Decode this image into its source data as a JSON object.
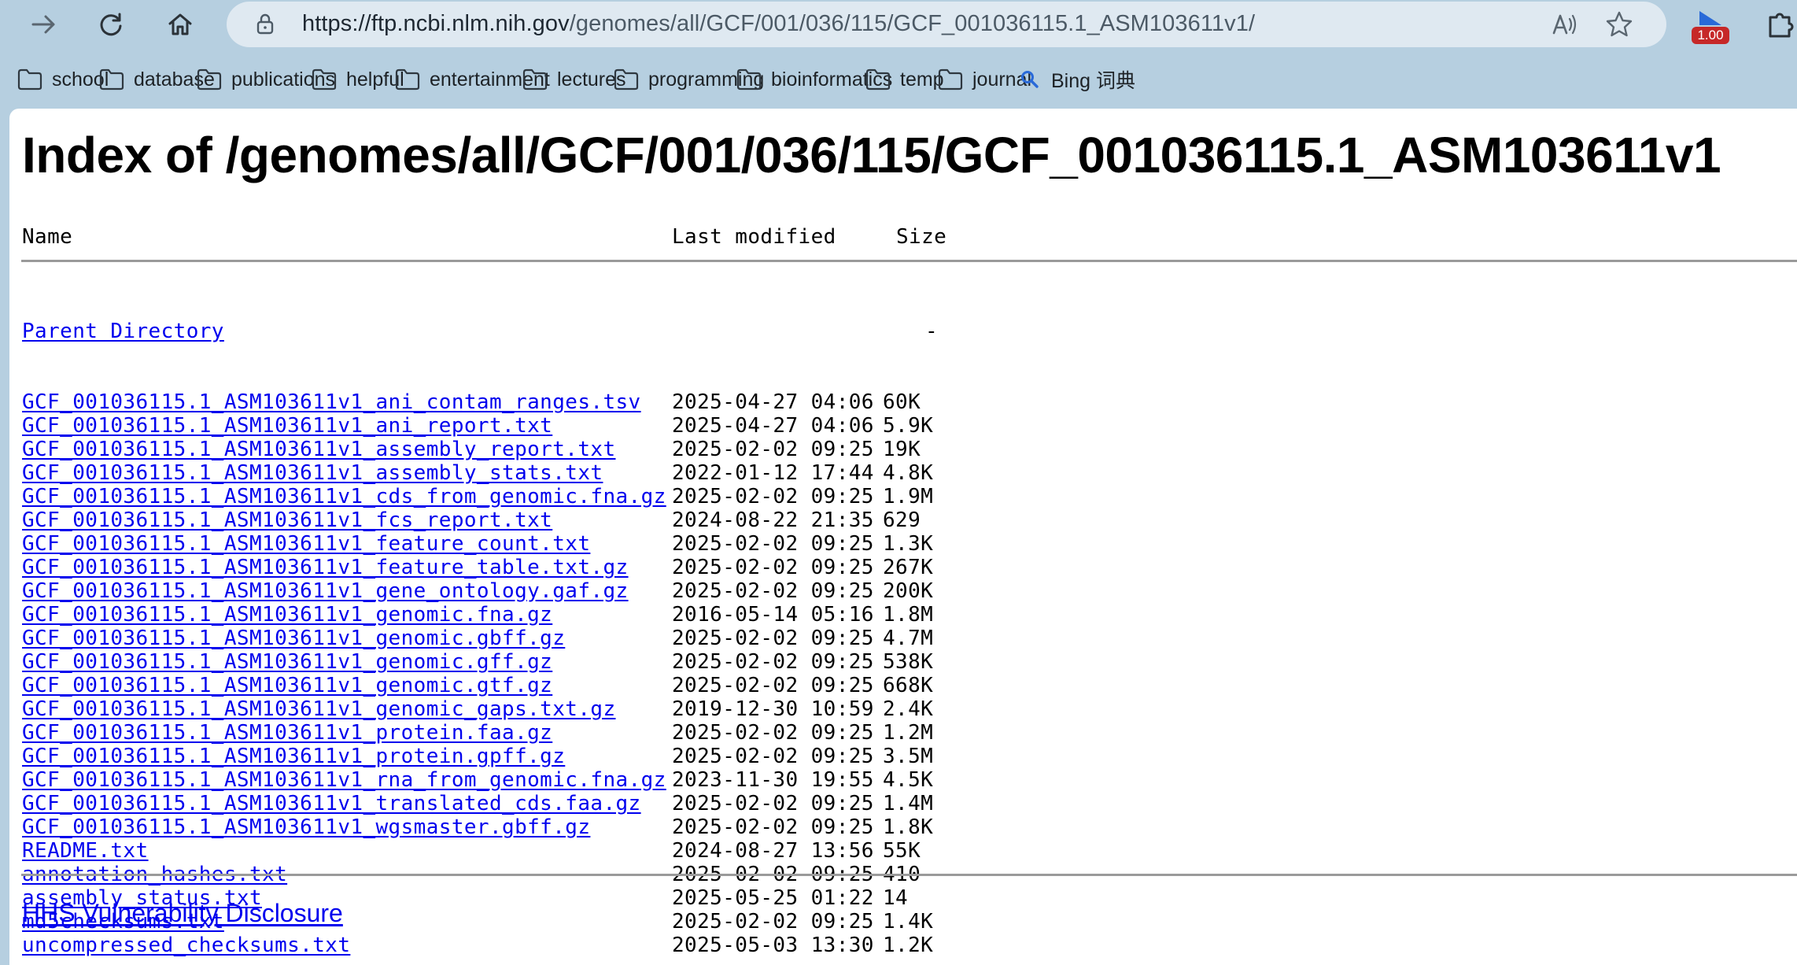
{
  "browser": {
    "url_host": "https://ftp.ncbi.nlm.nih.gov",
    "url_path": "/genomes/all/GCF/001/036/115/GCF_001036115.1_ASM103611v1/",
    "extension_badge": "1.00",
    "accent_color": "#2a6ad8",
    "badge_color": "#c62828"
  },
  "bookmarks": [
    {
      "label": "school",
      "icon": "folder-icon"
    },
    {
      "label": "database",
      "icon": "folder-icon"
    },
    {
      "label": "publications",
      "icon": "folder-icon"
    },
    {
      "label": "helpful",
      "icon": "folder-icon"
    },
    {
      "label": "entertainment",
      "icon": "folder-icon"
    },
    {
      "label": "lectures",
      "icon": "folder-icon"
    },
    {
      "label": "programming",
      "icon": "folder-icon"
    },
    {
      "label": "bioinformatics",
      "icon": "folder-icon"
    },
    {
      "label": "temp",
      "icon": "folder-icon"
    },
    {
      "label": "journal",
      "icon": "folder-icon"
    },
    {
      "label": "Bing 词典",
      "icon": "search-icon"
    }
  ],
  "page": {
    "title": "Index of /genomes/all/GCF/001/036/115/GCF_001036115.1_ASM103611v1",
    "columns": {
      "name": "Name",
      "modified": "Last modified",
      "size": "Size"
    },
    "parent": {
      "name": "Parent Directory",
      "modified": "",
      "size": "-"
    },
    "files": [
      {
        "name": "GCF_001036115.1_ASM103611v1_ani_contam_ranges.tsv",
        "modified": "2025-04-27 04:06",
        "size": "60K"
      },
      {
        "name": "GCF_001036115.1_ASM103611v1_ani_report.txt",
        "modified": "2025-04-27 04:06",
        "size": "5.9K"
      },
      {
        "name": "GCF_001036115.1_ASM103611v1_assembly_report.txt",
        "modified": "2025-02-02 09:25",
        "size": "19K"
      },
      {
        "name": "GCF_001036115.1_ASM103611v1_assembly_stats.txt",
        "modified": "2022-01-12 17:44",
        "size": "4.8K"
      },
      {
        "name": "GCF_001036115.1_ASM103611v1_cds_from_genomic.fna.gz",
        "modified": "2025-02-02 09:25",
        "size": "1.9M"
      },
      {
        "name": "GCF_001036115.1_ASM103611v1_fcs_report.txt",
        "modified": "2024-08-22 21:35",
        "size": "629"
      },
      {
        "name": "GCF_001036115.1_ASM103611v1_feature_count.txt",
        "modified": "2025-02-02 09:25",
        "size": "1.3K"
      },
      {
        "name": "GCF_001036115.1_ASM103611v1_feature_table.txt.gz",
        "modified": "2025-02-02 09:25",
        "size": "267K"
      },
      {
        "name": "GCF_001036115.1_ASM103611v1_gene_ontology.gaf.gz",
        "modified": "2025-02-02 09:25",
        "size": "200K"
      },
      {
        "name": "GCF_001036115.1_ASM103611v1_genomic.fna.gz",
        "modified": "2016-05-14 05:16",
        "size": "1.8M"
      },
      {
        "name": "GCF_001036115.1_ASM103611v1_genomic.gbff.gz",
        "modified": "2025-02-02 09:25",
        "size": "4.7M"
      },
      {
        "name": "GCF_001036115.1_ASM103611v1_genomic.gff.gz",
        "modified": "2025-02-02 09:25",
        "size": "538K"
      },
      {
        "name": "GCF_001036115.1_ASM103611v1_genomic.gtf.gz",
        "modified": "2025-02-02 09:25",
        "size": "668K"
      },
      {
        "name": "GCF_001036115.1_ASM103611v1_genomic_gaps.txt.gz",
        "modified": "2019-12-30 10:59",
        "size": "2.4K"
      },
      {
        "name": "GCF_001036115.1_ASM103611v1_protein.faa.gz",
        "modified": "2025-02-02 09:25",
        "size": "1.2M"
      },
      {
        "name": "GCF_001036115.1_ASM103611v1_protein.gpff.gz",
        "modified": "2025-02-02 09:25",
        "size": "3.5M"
      },
      {
        "name": "GCF_001036115.1_ASM103611v1_rna_from_genomic.fna.gz",
        "modified": "2023-11-30 19:55",
        "size": "4.5K"
      },
      {
        "name": "GCF_001036115.1_ASM103611v1_translated_cds.faa.gz",
        "modified": "2025-02-02 09:25",
        "size": "1.4M"
      },
      {
        "name": "GCF_001036115.1_ASM103611v1_wgsmaster.gbff.gz",
        "modified": "2025-02-02 09:25",
        "size": "1.8K"
      },
      {
        "name": "README.txt",
        "modified": "2024-08-27 13:56",
        "size": "55K"
      },
      {
        "name": "annotation_hashes.txt",
        "modified": "2025-02-02 09:25",
        "size": "410"
      },
      {
        "name": "assembly_status.txt",
        "modified": "2025-05-25 01:22",
        "size": "14"
      },
      {
        "name": "md5checksums.txt",
        "modified": "2025-02-02 09:25",
        "size": "1.4K"
      },
      {
        "name": "uncompressed_checksums.txt",
        "modified": "2025-05-03 13:30",
        "size": "1.2K"
      }
    ],
    "footer_link": "HHS Vulnerability Disclosure"
  }
}
